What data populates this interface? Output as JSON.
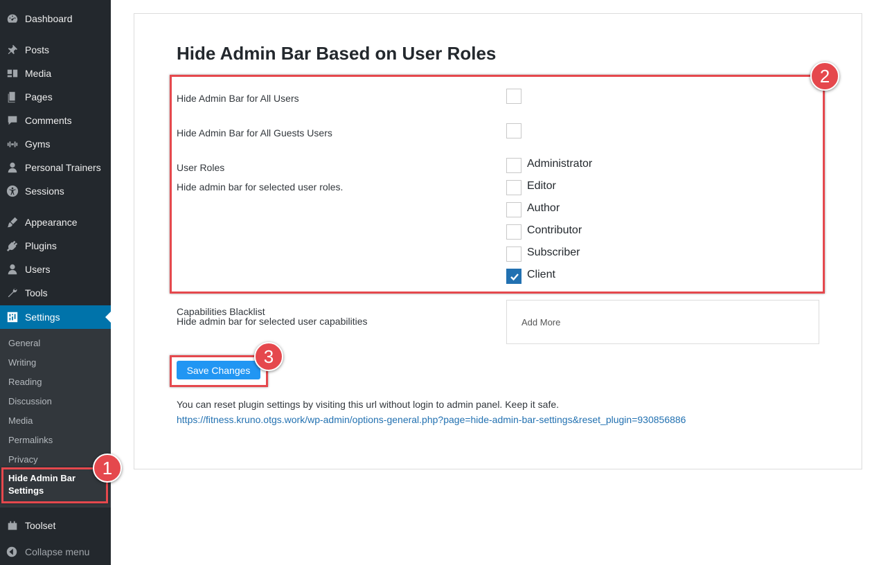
{
  "sidebar": {
    "items": [
      {
        "label": "Dashboard",
        "icon": "dashboard-icon"
      },
      {
        "label": "Posts",
        "icon": "pin-icon"
      },
      {
        "label": "Media",
        "icon": "media-icon"
      },
      {
        "label": "Pages",
        "icon": "pages-icon"
      },
      {
        "label": "Comments",
        "icon": "comment-icon"
      },
      {
        "label": "Gyms",
        "icon": "gym-icon"
      },
      {
        "label": "Personal Trainers",
        "icon": "person-icon"
      },
      {
        "label": "Sessions",
        "icon": "universal-access-icon"
      },
      {
        "label": "Appearance",
        "icon": "brush-icon"
      },
      {
        "label": "Plugins",
        "icon": "plugin-icon"
      },
      {
        "label": "Users",
        "icon": "user-icon"
      },
      {
        "label": "Tools",
        "icon": "wrench-icon"
      },
      {
        "label": "Settings",
        "icon": "settings-icon"
      },
      {
        "label": "Toolset",
        "icon": "toolset-icon"
      }
    ],
    "submenu": [
      "General",
      "Writing",
      "Reading",
      "Discussion",
      "Media",
      "Permalinks",
      "Privacy",
      "Hide Admin Bar Settings"
    ],
    "collapse_label": "Collapse menu"
  },
  "main": {
    "title": "Hide Admin Bar Based on User Roles",
    "all_users_label": "Hide Admin Bar for All Users",
    "all_guests_label": "Hide Admin Bar for All Guests Users",
    "user_roles_label": "User Roles",
    "user_roles_desc": "Hide admin bar for selected user roles.",
    "roles": [
      {
        "name": "Administrator",
        "checked": false
      },
      {
        "name": "Editor",
        "checked": false
      },
      {
        "name": "Author",
        "checked": false
      },
      {
        "name": "Contributor",
        "checked": false
      },
      {
        "name": "Subscriber",
        "checked": false
      },
      {
        "name": "Client",
        "checked": true
      }
    ],
    "cap_label": "Capabilities Blacklist",
    "cap_desc": "Hide admin bar for selected user capabilities",
    "cap_placeholder": "Add More",
    "save_label": "Save Changes",
    "reset_note": "You can reset plugin settings by visiting this url without login to admin panel. Keep it safe.",
    "reset_url": "https://fitness.kruno.otgs.work/wp-admin/options-general.php?page=hide-admin-bar-settings&reset_plugin=930856886"
  },
  "annotations": {
    "badge1": "1",
    "badge2": "2",
    "badge3": "3",
    "color": "#e5484d"
  },
  "colors": {
    "sidebar_bg": "#23282d",
    "active": "#0073aa",
    "button": "#2196f3"
  }
}
